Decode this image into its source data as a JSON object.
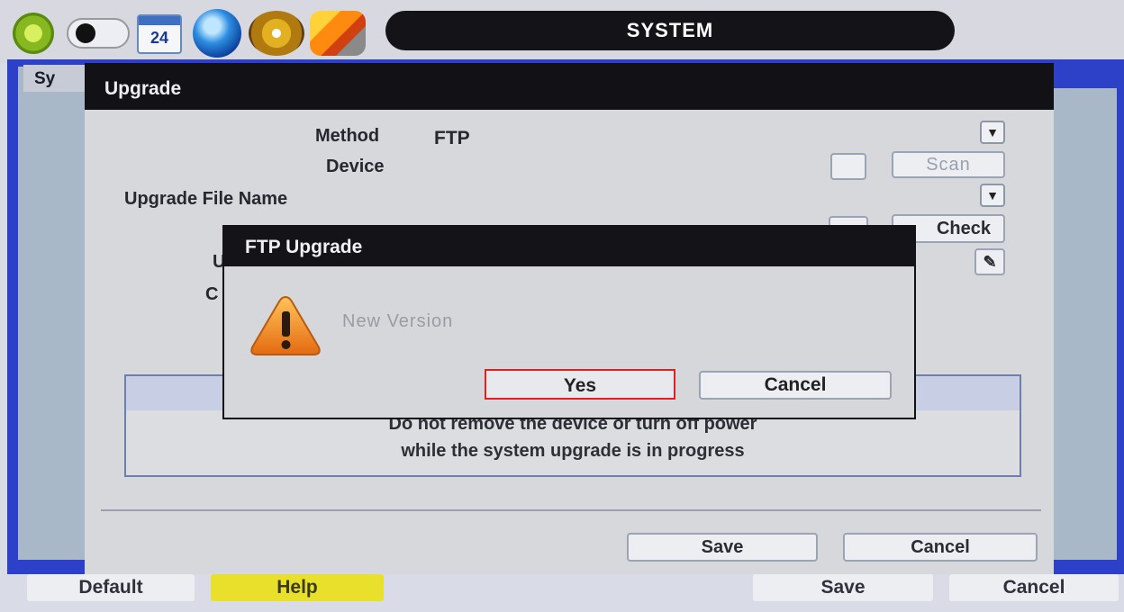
{
  "topbar": {
    "title": "SYSTEM",
    "calendar_text": "24",
    "icons": [
      "gear-icon",
      "toggle-icon",
      "calendar-icon",
      "network-globe-icon",
      "disc-icon",
      "tools-icon"
    ]
  },
  "background_tab": {
    "label": "Sy"
  },
  "upgrade": {
    "title": "Upgrade",
    "method_label": "Method",
    "method_value": "FTP",
    "device_label": "Device",
    "scan_label": "Scan",
    "file_name_label": "Upgrade File Name",
    "check_label": "Check",
    "partial_label_1": "U",
    "partial_label_2": "C",
    "warning_line1": "Do not remove the device or turn off power",
    "warning_line2": "while the system upgrade is in progress",
    "save_label": "Save",
    "cancel_label": "Cancel"
  },
  "dialog": {
    "title": "FTP Upgrade",
    "message": "New Version",
    "yes_label": "Yes",
    "cancel_label": "Cancel"
  },
  "bottombar": {
    "default_label": "Default",
    "help_label": "Help",
    "save_label": "Save",
    "cancel_label": "Cancel"
  },
  "colors": {
    "main_blue": "#2d40c8",
    "title_black": "#141418",
    "help_yellow": "#e8e02a",
    "highlight_red": "#e02020",
    "warning_orange": "#f08a1c"
  }
}
